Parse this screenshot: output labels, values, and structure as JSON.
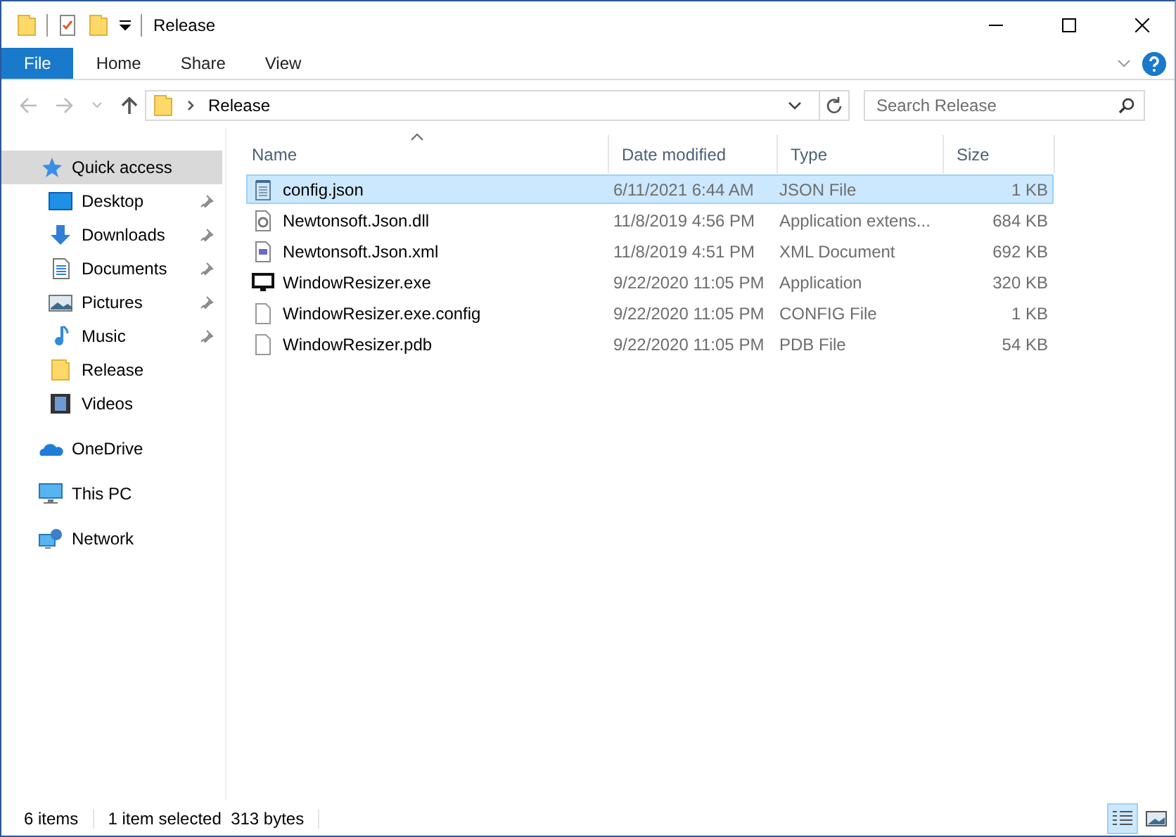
{
  "window": {
    "title": "Release"
  },
  "ribbon": {
    "tabs": [
      {
        "label": "File",
        "kind": "file"
      },
      {
        "label": "Home",
        "kind": "tab"
      },
      {
        "label": "Share",
        "kind": "tab"
      },
      {
        "label": "View",
        "kind": "tab"
      }
    ]
  },
  "address": {
    "path": [
      "Release"
    ]
  },
  "search": {
    "placeholder": "Search Release"
  },
  "sidebar": {
    "items": [
      {
        "label": "Quick access",
        "kind": "star",
        "selected": true,
        "pinned": false,
        "children": [
          {
            "label": "Desktop",
            "kind": "desktop",
            "selected": false,
            "pinned": true
          },
          {
            "label": "Downloads",
            "kind": "download",
            "selected": false,
            "pinned": true
          },
          {
            "label": "Documents",
            "kind": "document",
            "selected": false,
            "pinned": true
          },
          {
            "label": "Pictures",
            "kind": "pictures",
            "selected": false,
            "pinned": true
          },
          {
            "label": "Music",
            "kind": "music",
            "selected": false,
            "pinned": true
          },
          {
            "label": "Release",
            "kind": "folder",
            "selected": false,
            "pinned": false
          },
          {
            "label": "Videos",
            "kind": "videos",
            "selected": false,
            "pinned": false
          }
        ]
      },
      {
        "label": "OneDrive",
        "kind": "cloud",
        "selected": false,
        "pinned": false
      },
      {
        "label": "This PC",
        "kind": "pc",
        "selected": false,
        "pinned": false
      },
      {
        "label": "Network",
        "kind": "network",
        "selected": false,
        "pinned": false
      }
    ]
  },
  "table": {
    "columns": [
      {
        "label": "Name",
        "sorted": true
      },
      {
        "label": "Date modified",
        "sorted": false
      },
      {
        "label": "Type",
        "sorted": false
      },
      {
        "label": "Size",
        "sorted": false
      }
    ],
    "rows": [
      {
        "kind": "notepad",
        "name": "config.json",
        "date": "6/11/2021 6:44 AM",
        "type": "JSON File",
        "size": "1 KB",
        "selected": true
      },
      {
        "kind": "gear",
        "name": "Newtonsoft.Json.dll",
        "date": "11/8/2019 4:56 PM",
        "type": "Application extens...",
        "size": "684 KB",
        "selected": false
      },
      {
        "kind": "xml",
        "name": "Newtonsoft.Json.xml",
        "date": "11/8/2019 4:51 PM",
        "type": "XML Document",
        "size": "692 KB",
        "selected": false
      },
      {
        "kind": "monitor",
        "name": "WindowResizer.exe",
        "date": "9/22/2020 11:05 PM",
        "type": "Application",
        "size": "320 KB",
        "selected": false
      },
      {
        "kind": "blank",
        "name": "WindowResizer.exe.config",
        "date": "9/22/2020 11:05 PM",
        "type": "CONFIG File",
        "size": "1 KB",
        "selected": false
      },
      {
        "kind": "blank",
        "name": "WindowResizer.pdb",
        "date": "9/22/2020 11:05 PM",
        "type": "PDB File",
        "size": "54 KB",
        "selected": false
      }
    ]
  },
  "status_bar": {
    "items": [
      "6 items",
      "1 item selected  313 bytes"
    ],
    "views": [
      {
        "kind": "details",
        "selected": true
      },
      {
        "kind": "large-icons",
        "selected": false
      }
    ]
  }
}
